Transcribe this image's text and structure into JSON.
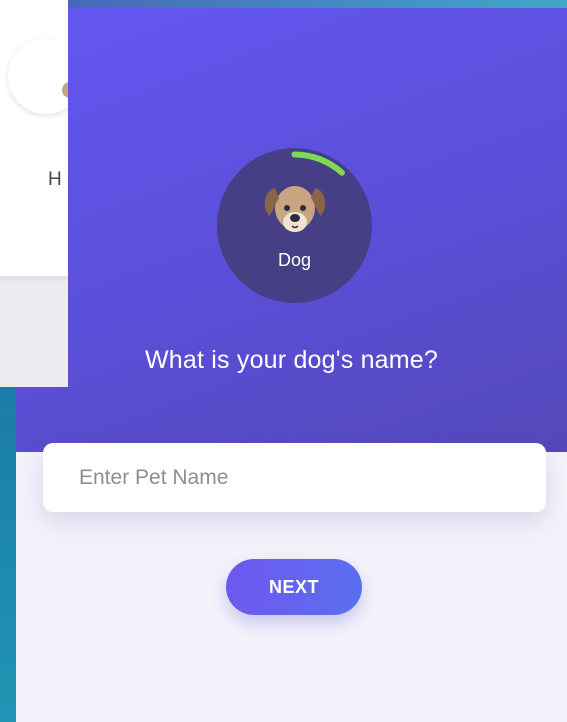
{
  "pet": {
    "type_label": "Dog",
    "icon": "dog-icon"
  },
  "question": "What is your dog's name?",
  "name_input": {
    "placeholder": "Enter Pet Name",
    "value": ""
  },
  "next_button": {
    "label": "NEXT"
  },
  "overlay_window": {
    "partial_text": "H"
  },
  "colors": {
    "hero_start": "#6457f2",
    "hero_end": "#5548b9",
    "avatar_bg": "#463f86",
    "progress_arc": "#7ed957",
    "page_bg": "#f3f2fb",
    "button_start": "#6e58ef",
    "button_end": "#5a6ff0"
  }
}
